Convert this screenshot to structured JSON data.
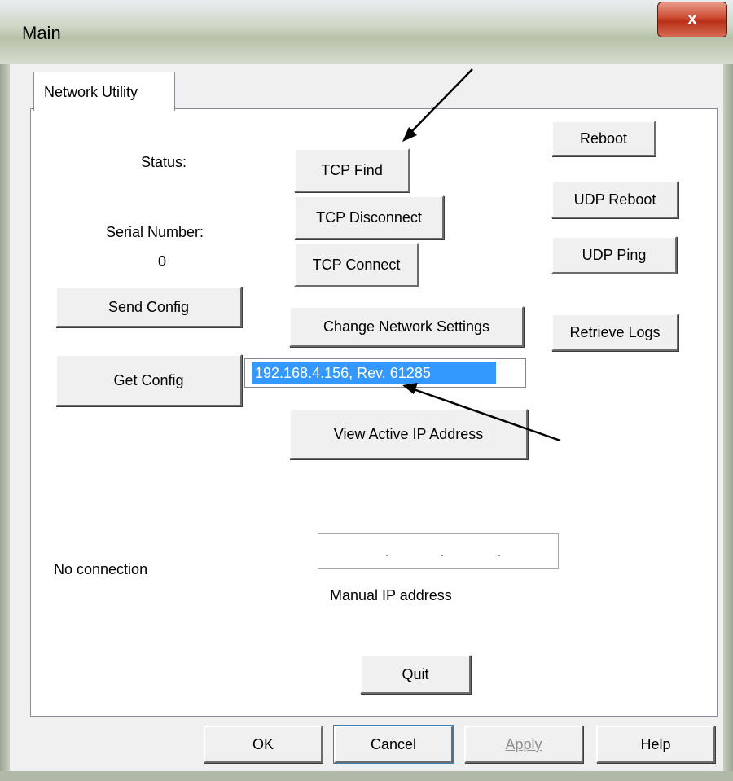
{
  "window": {
    "title": "Main",
    "close_glyph": "x"
  },
  "tab": {
    "label": "Network Utility"
  },
  "labels": {
    "status": "Status:",
    "serial_number": "Serial Number:",
    "serial_value": "0",
    "connection": "No connection",
    "manual_ip": "Manual IP address"
  },
  "buttons": {
    "tcp_find": "TCP Find",
    "tcp_disconnect": "TCP Disconnect",
    "tcp_connect": "TCP Connect",
    "send_config": "Send Config",
    "get_config": "Get Config",
    "change_network": "Change Network Settings",
    "view_active_ip": "View Active IP Address",
    "reboot": "Reboot",
    "udp_reboot": "UDP Reboot",
    "udp_ping": "UDP Ping",
    "retrieve_logs": "Retrieve Logs",
    "quit": "Quit"
  },
  "device_combo": {
    "selected": "192.168.4.156, Rev. 61285"
  },
  "ip_field": {
    "dot1": ".",
    "dot2": ".",
    "dot3": "."
  },
  "dialog_buttons": {
    "ok": "OK",
    "cancel": "Cancel",
    "apply": "Apply",
    "help": "Help"
  },
  "icons": {
    "close": "close-icon",
    "dropdown": "chevron-down-icon"
  },
  "colors": {
    "selection": "#3399ff",
    "close_button": "#c9432c"
  }
}
